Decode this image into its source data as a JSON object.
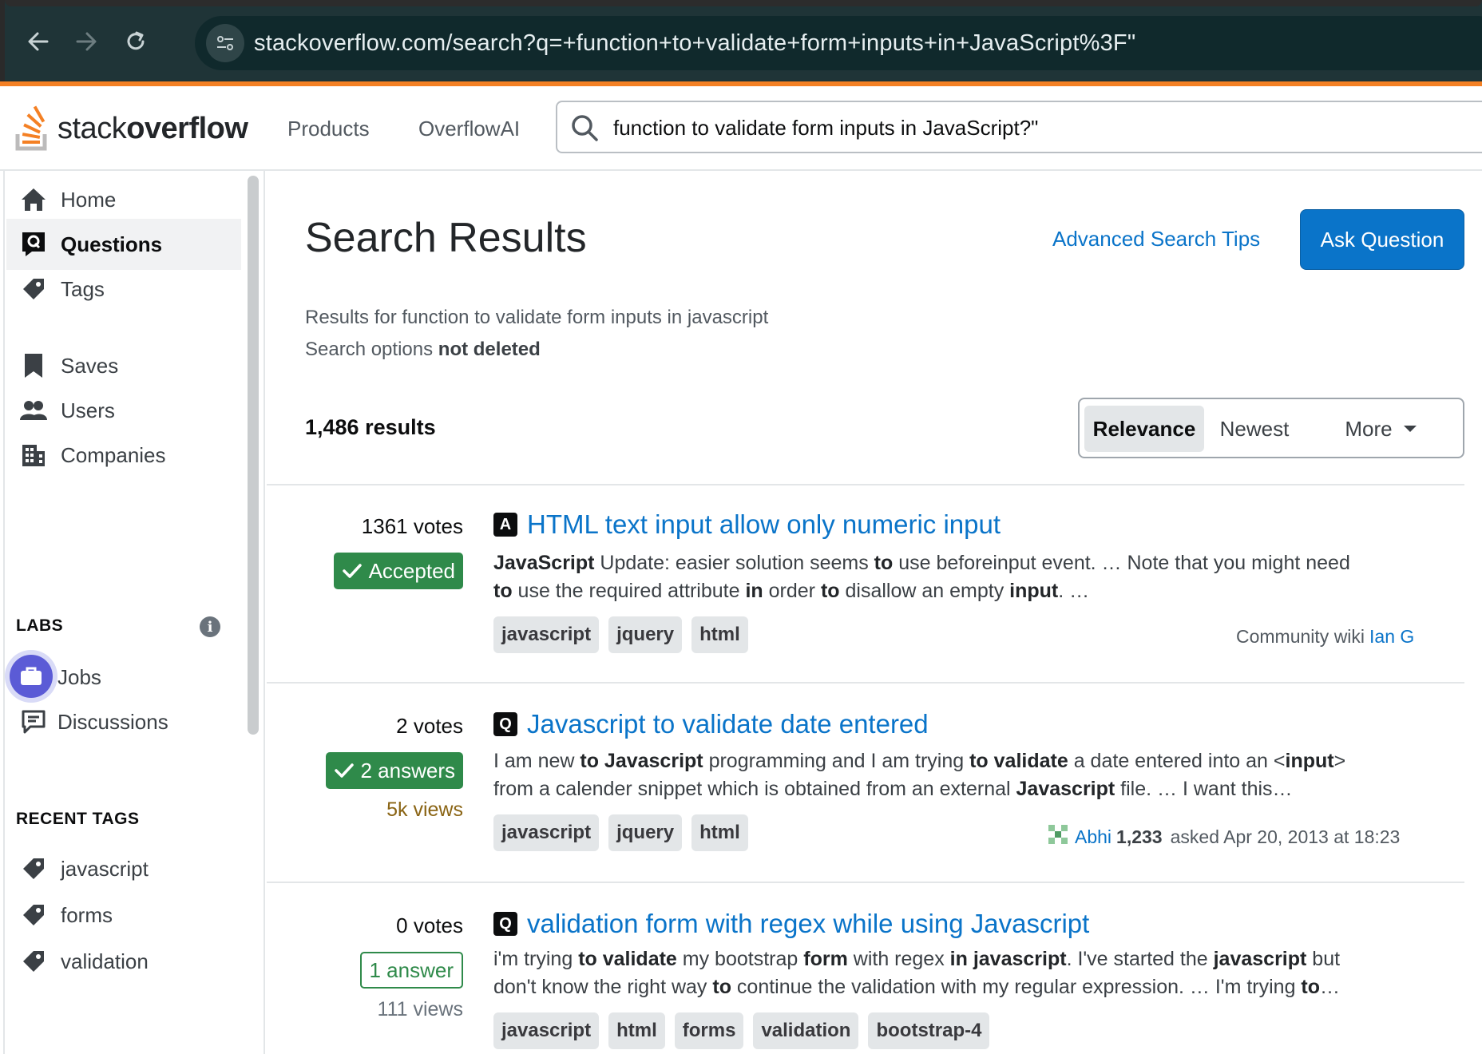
{
  "browser": {
    "url": "stackoverflow.com/search?q=+function+to+validate+form+inputs+in+JavaScript%3F\""
  },
  "header": {
    "logo_light": "stack",
    "logo_bold": "overflow",
    "nav": [
      "Products",
      "OverflowAI"
    ],
    "search_value": "function to validate form inputs in JavaScript?\""
  },
  "sidebar": {
    "items": [
      {
        "label": "Home",
        "icon": "home-icon"
      },
      {
        "label": "Questions",
        "icon": "questions-icon",
        "active": true
      },
      {
        "label": "Tags",
        "icon": "tag-icon"
      },
      {
        "label": "Saves",
        "icon": "bookmark-icon"
      },
      {
        "label": "Users",
        "icon": "users-icon"
      },
      {
        "label": "Companies",
        "icon": "building-icon"
      }
    ],
    "labs_heading": "LABS",
    "labs_items": [
      {
        "label": "Jobs",
        "icon": "briefcase-icon"
      },
      {
        "label": "Discussions",
        "icon": "discussion-icon"
      }
    ],
    "recent_tags_heading": "RECENT TAGS",
    "recent_tags": [
      "javascript",
      "forms",
      "validation"
    ]
  },
  "main": {
    "title": "Search Results",
    "advanced_link": "Advanced Search Tips",
    "ask_button": "Ask Question",
    "results_for": "Results for function to validate form inputs in javascript",
    "search_options_prefix": "Search options",
    "search_options_value": "not deleted",
    "count": "1,486 results",
    "sort": [
      "Relevance",
      "Newest",
      "More"
    ]
  },
  "results": [
    {
      "votes": "1361 votes",
      "badge": "Accepted",
      "kind": "A",
      "title": "HTML text input allow only numeric input",
      "excerpt_line1": "<b>JavaScript</b> Update: easier solution seems <b>to</b> use beforeinput event. … Note that you might need",
      "excerpt_line2": "<b>to</b> use the required attribute <b>in</b> order <b>to</b> disallow an empty <b>input</b>. …",
      "tags": [
        "javascript",
        "jquery",
        "html"
      ],
      "meta_prefix": "Community wiki",
      "user": "Ian G"
    },
    {
      "votes": "2 votes",
      "badge": "2 answers",
      "views": "5k views",
      "kind": "Q",
      "title": "Javascript to validate date entered",
      "excerpt_line1": "I am new <b>to Javascript</b> programming and I am trying <b>to validate</b> a date entered into an &lt;<b>input</b>&gt;",
      "excerpt_line2": "from a calender snippet which is obtained from an external <b>Javascript</b> file. … I want this…",
      "tags": [
        "javascript",
        "jquery",
        "html"
      ],
      "user": "Abhi",
      "rep": "1,233",
      "asked": "asked Apr 20, 2013 at 18:23"
    },
    {
      "votes": "0 votes",
      "badge": "1 answer",
      "views": "111 views",
      "kind": "Q",
      "title": "validation form with regex while using Javascript",
      "excerpt_line1": "i'm trying <b>to validate</b> my bootstrap <b>form</b> with regex <b>in javascript</b>. I've started the <b>javascript</b> but",
      "excerpt_line2": "don't know the right way <b>to</b> continue the validation with my regular expression. … I'm trying <b>to</b>…",
      "tags": [
        "javascript",
        "html",
        "forms",
        "validation",
        "bootstrap-4"
      ]
    }
  ],
  "colors": {
    "accent_blue": "#0a74c9",
    "so_orange": "#f48024",
    "accepted_green": "#2f8a4a",
    "views_hot": "#8a6414",
    "browser_bg": "#1f3437"
  }
}
